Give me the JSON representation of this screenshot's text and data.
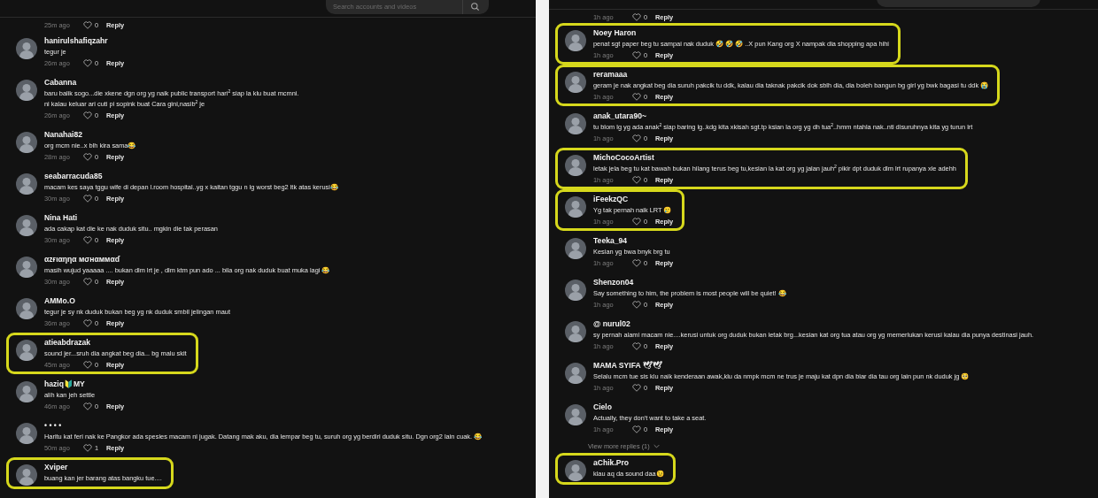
{
  "left_panel": {
    "search": {
      "placeholder": "Search accounts and videos"
    },
    "top_meta": {
      "time": "25m ago",
      "likes": "0",
      "reply": "Reply"
    },
    "comments": [
      {
        "kind": "comment",
        "name": "hanirulshafiqzahr",
        "text": "tegur je",
        "time": "26m ago",
        "likes": "0",
        "reply": "Reply",
        "highlighted": false
      },
      {
        "kind": "comment",
        "name": "Cabanna",
        "text": "baru balik sogo...die xkene dgn org yg naik public transport hari$^{2}$ siap la klu buat mcmni.\nni kalau keluar ari cuti pi sopink buat Cara gini,nasib$^{2}$ je",
        "time": "26m ago",
        "likes": "0",
        "reply": "Reply",
        "highlighted": false
      },
      {
        "kind": "comment",
        "name": "Nanahai82",
        "text": "org mcm nie..x blh kira sama😂",
        "time": "28m ago",
        "likes": "0",
        "reply": "Reply",
        "highlighted": false
      },
      {
        "kind": "comment",
        "name": "seabarracuda85",
        "text": "macam kes saya tggu wife di depan l.room hospital..yg x kaitan tggu n lg worst beg2 ltk atas kerusi😂",
        "time": "30m ago",
        "likes": "0",
        "reply": "Reply",
        "highlighted": false
      },
      {
        "kind": "comment",
        "name": "Nina Hati",
        "text": "ada cakap kat die ke nak duduk situ.. mgkin die tak perasan",
        "time": "30m ago",
        "likes": "0",
        "reply": "Reply",
        "highlighted": false
      },
      {
        "kind": "comment",
        "name": "αzғιαηηα мσнαммαɗ",
        "text": "masih wujud yaaaaa .... bukan dlm lrt je , dlm ktm pun ado ... bila org nak duduk buat muka lagi 😂",
        "time": "30m ago",
        "likes": "0",
        "reply": "Reply",
        "highlighted": false
      },
      {
        "kind": "comment",
        "name": "AMMo.O",
        "text": "tegur je sy nk duduk bukan beg yg nk duduk smbil jelingan maut",
        "time": "36m ago",
        "likes": "0",
        "reply": "Reply",
        "highlighted": false
      },
      {
        "kind": "comment",
        "name": "atieabdrazak",
        "text": "sound jer...sruh dia angkat beg dia... bg malu skit",
        "time": "45m ago",
        "likes": "0",
        "reply": "Reply",
        "highlighted": true
      },
      {
        "kind": "comment",
        "name": "haziq🔰MY",
        "text": "alih kan jeh settle",
        "time": "46m ago",
        "likes": "0",
        "reply": "Reply",
        "highlighted": false
      },
      {
        "kind": "comment",
        "name": "• • • •",
        "text": "Haritu kat feri nak ke Pangkor ada spesies macam ni jugak. Datang mak aku, dia lempar beg tu, suruh org yg berdiri duduk situ. Dgn org2 lain cuak. 😂",
        "time": "50m ago",
        "likes": "1",
        "reply": "Reply",
        "highlighted": false
      },
      {
        "kind": "comment",
        "name": "Xviper",
        "text": "buang kan jer barang atas bangku tue....",
        "highlighted": true
      }
    ]
  },
  "right_panel": {
    "top_meta": {
      "time": "1h ago",
      "likes": "0",
      "reply": "Reply"
    },
    "comments": [
      {
        "kind": "comment",
        "name": "Noey Haron",
        "text": "penat sgt paper beg tu sampai nak duduk 🤣 🤣 🤣 ..X pun Kang org X nampak dia shopping apa hihi",
        "time": "1h ago",
        "likes": "0",
        "reply": "Reply",
        "highlighted": true
      },
      {
        "kind": "comment",
        "name": "reramaaa",
        "text": "geram je nak angkat beg dia suruh pakcik tu ddk, kalau dia taknak pakcik dok sblh dia, dia boleh bangun bg girl yg bwk bagasi tu ddk 😭",
        "time": "1h ago",
        "likes": "0",
        "reply": "Reply",
        "highlighted": true
      },
      {
        "kind": "comment",
        "name": "anak_utara90~",
        "text": "tu blom lg yg ada anak$^{2}$ siap baring lg..kdg kita xkisah sgt.tp ksian la org yg dh tua$^{2}$..hmm ntahla nak..nti disuruhnya kita yg turun lrt",
        "time": "1h ago",
        "likes": "0",
        "reply": "Reply",
        "highlighted": false
      },
      {
        "kind": "comment",
        "name": "MichoCocoArtist",
        "text": "letak jela beg tu kat bawah bukan hilang terus beg tu,kesian la kat org yg jalan jauh$^{2}$ pikir dpt duduk dlm lrt rupanya xle adehh",
        "time": "1h ago",
        "likes": "0",
        "reply": "Reply",
        "highlighted": true
      },
      {
        "kind": "comment",
        "name": "iFeekzQC",
        "text": "Yg tak pernah naik LRT 🥲",
        "time": "1h ago",
        "likes": "0",
        "reply": "Reply",
        "highlighted": true
      },
      {
        "kind": "comment",
        "name": "Teeka_94",
        "text": "Kesian yg bwa bnyk brg tu",
        "time": "1h ago",
        "likes": "0",
        "reply": "Reply",
        "highlighted": false
      },
      {
        "kind": "comment",
        "name": "Shenzon04",
        "text": "Say something to him, the problem is most people will be quiet! 😂",
        "time": "1h ago",
        "likes": "0",
        "reply": "Reply",
        "highlighted": false
      },
      {
        "kind": "comment",
        "name": "@ nurul02",
        "text": "sy pernah alami macam nie....kerusi untuk org duduk bukan letak brg...kesian kat org tua atau org yg memerlukan kerusi kalau dia punya destinasi jauh.",
        "time": "1h ago",
        "likes": "0",
        "reply": "Reply",
        "highlighted": false
      },
      {
        "kind": "comment",
        "name": "MAMA SYIFA 🕊🕊",
        "text": "Selalu mcm tue sis klu naik kenderaan awak,klu da nmpk mcm ne trus je maju kat dpn dia biar dia tau org lain pun nk duduk jg 🥺",
        "time": "1h ago",
        "likes": "0",
        "reply": "Reply",
        "highlighted": false
      },
      {
        "kind": "comment",
        "name": "Cielo",
        "text": "Actually, they don't want to take a seat.",
        "time": "1h ago",
        "likes": "0",
        "reply": "Reply",
        "highlighted": false
      },
      {
        "kind": "more_replies",
        "label": "View more replies (1)"
      },
      {
        "kind": "comment",
        "name": "aChik.Pro",
        "text": "klau aq da sound daa😉",
        "highlighted": true
      }
    ]
  }
}
